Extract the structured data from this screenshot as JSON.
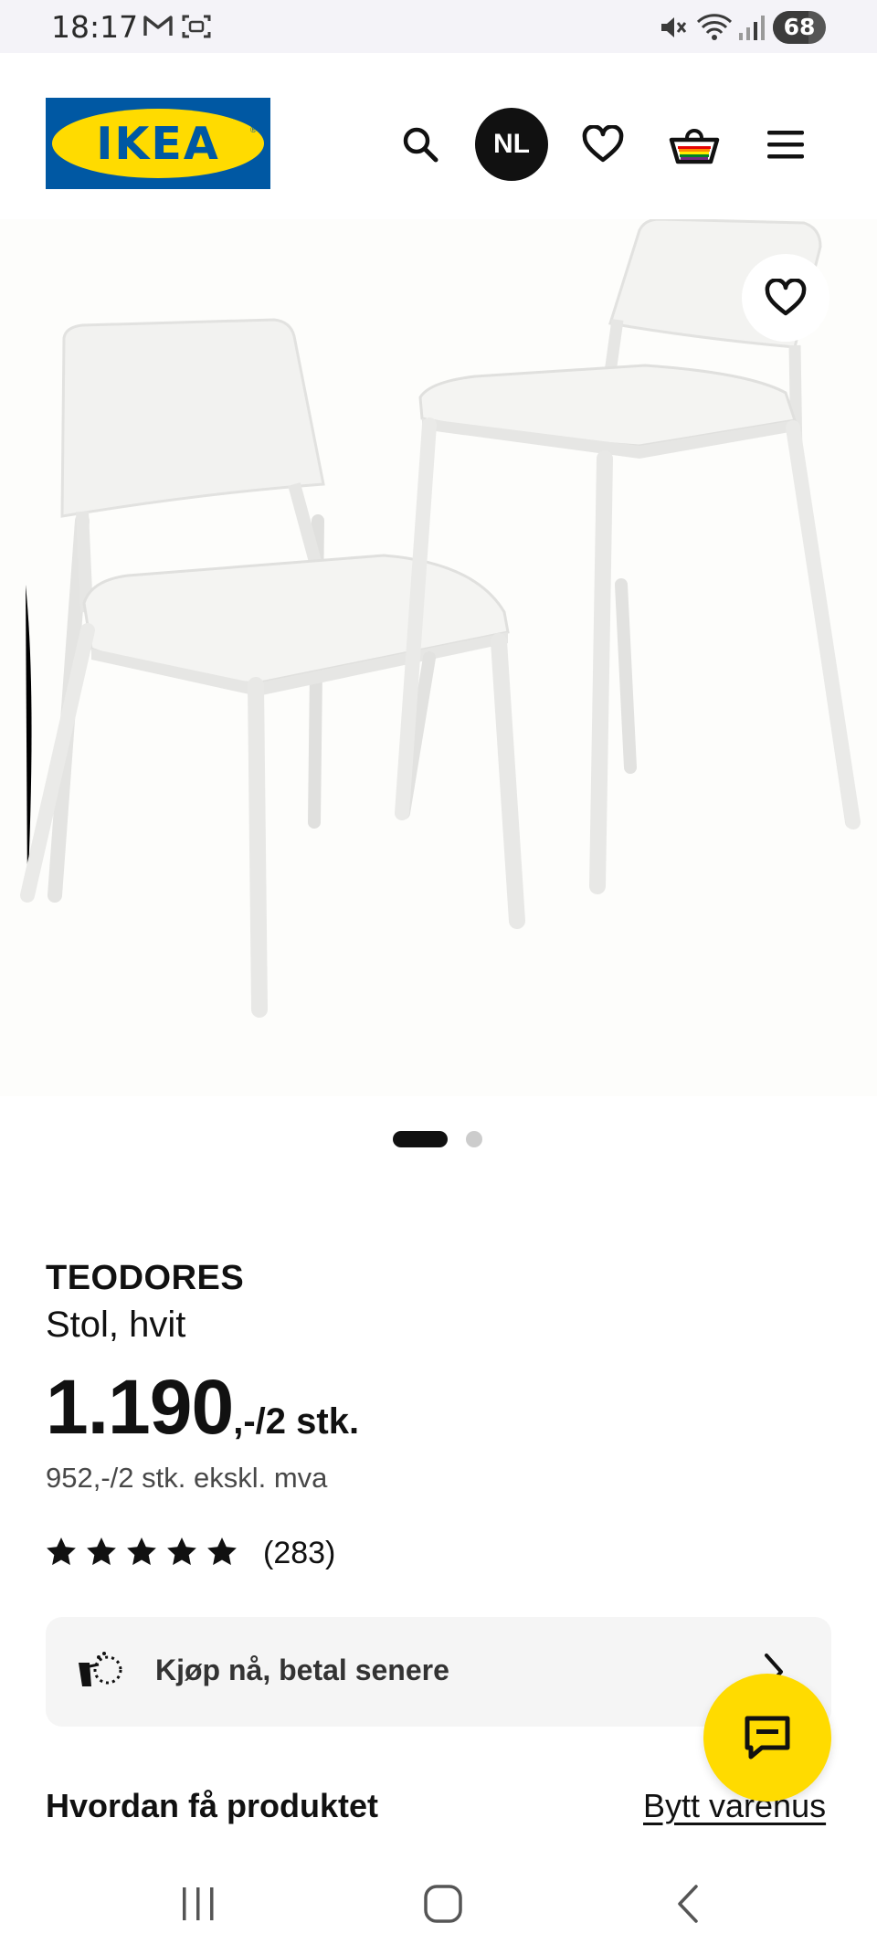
{
  "status_bar": {
    "time": "18:17",
    "battery": "68",
    "battery_level": 0.68,
    "icons": [
      "gmail-icon",
      "screenshot-icon",
      "mute-icon",
      "wifi-icon",
      "signal-icon"
    ]
  },
  "header": {
    "logo_text": "IKEA",
    "logo_mark": "®",
    "locale_badge": "NL",
    "icons": [
      "search-icon",
      "heart-icon",
      "basket-icon",
      "menu-icon"
    ]
  },
  "gallery": {
    "image_alt": "TEODORES Stol, hvit",
    "slide_count": 2,
    "active_slide": 1
  },
  "product": {
    "name": "TEODORES",
    "description": "Stol, hvit",
    "price_main": "1.190",
    "price_unit": ",-/2 stk.",
    "price_excl_vat": "952,-/2 stk. ekskl. mva",
    "rating_stars": 5,
    "review_count": "(283)"
  },
  "pay_later": {
    "label": "Kjøp nå, betal senere"
  },
  "delivery": {
    "title": "Hvordan få produktet",
    "change_store_link": "Bytt varehus"
  },
  "colors": {
    "ikea_blue": "#0058a3",
    "ikea_yellow": "#ffdb00",
    "text": "#111111"
  },
  "nav_bar": {
    "icons": [
      "recent-apps-icon",
      "home-icon",
      "back-icon"
    ]
  }
}
